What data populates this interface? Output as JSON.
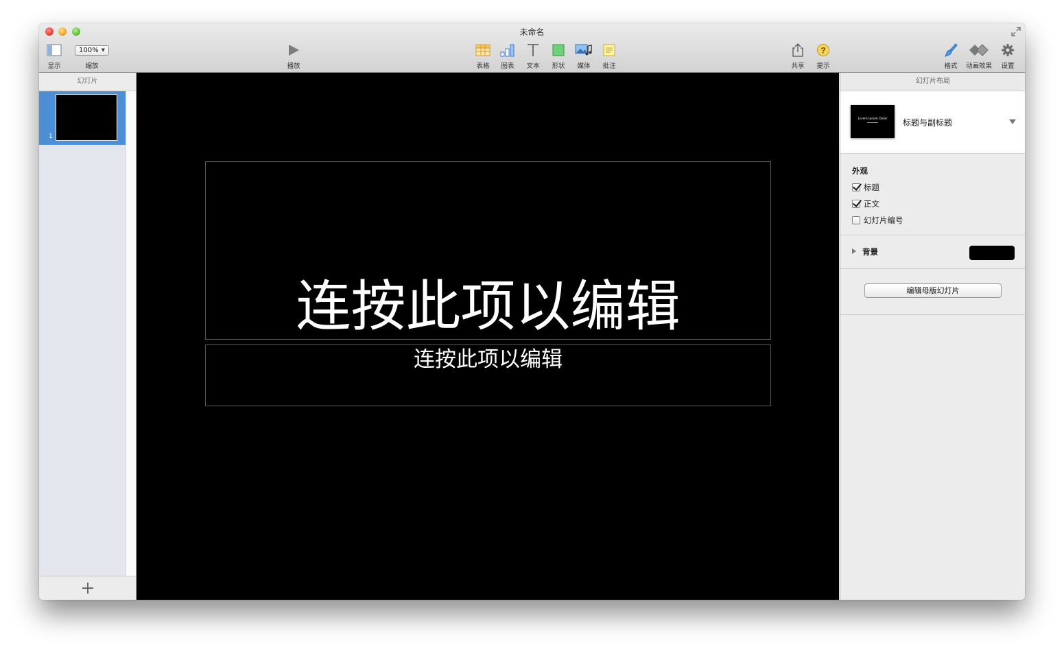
{
  "window": {
    "title": "未命名"
  },
  "toolbar": {
    "view_label": "显示",
    "zoom_value": "100%",
    "zoom_label": "缩放",
    "play_label": "播放",
    "table_label": "表格",
    "chart_label": "图表",
    "text_label": "文本",
    "shape_label": "形状",
    "media_label": "媒体",
    "comment_label": "批注",
    "share_label": "共享",
    "tips_label": "提示",
    "format_label": "格式",
    "animate_label": "动画效果",
    "settings_label": "设置"
  },
  "sidebar": {
    "header": "幻灯片",
    "slides": [
      {
        "number": "1"
      }
    ]
  },
  "slide": {
    "title": "连按此项以编辑",
    "subtitle": "连按此项以编辑"
  },
  "inspector": {
    "header": "幻灯片布局",
    "layout": {
      "thumb_text": "Lorem Ipsum Dolor",
      "name": "标题与副标题"
    },
    "appearance": {
      "title": "外观",
      "options": [
        {
          "label": "标题",
          "checked": true
        },
        {
          "label": "正文",
          "checked": true
        },
        {
          "label": "幻灯片编号",
          "checked": false
        }
      ]
    },
    "background": {
      "label": "背景",
      "color": "#000000"
    },
    "edit_master_label": "编辑母版幻灯片"
  },
  "colors": {
    "selection": "#4d8fd7",
    "canvas": "#000000"
  }
}
